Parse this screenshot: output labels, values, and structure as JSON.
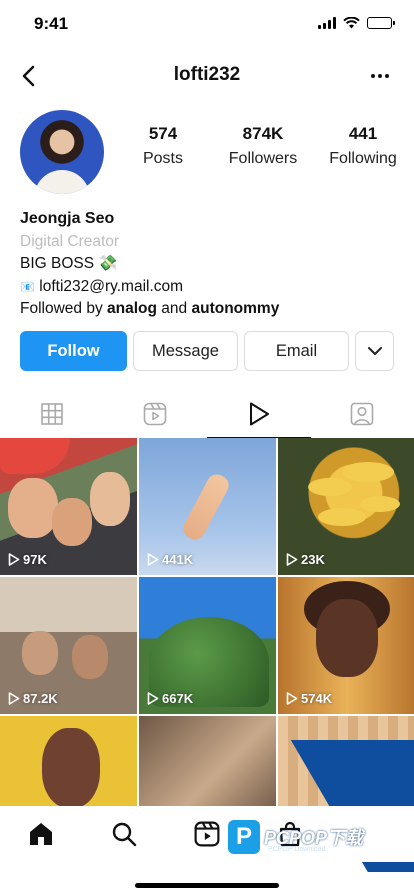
{
  "status_bar": {
    "time": "9:41"
  },
  "header": {
    "username": "lofti232"
  },
  "profile": {
    "stats": [
      {
        "value": "574",
        "label": "Posts"
      },
      {
        "value": "874K",
        "label": "Followers"
      },
      {
        "value": "441",
        "label": "Following"
      }
    ],
    "name": "Jeongja Seo",
    "category": "Digital Creator",
    "bio_line": "BIG BOSS",
    "bio_emoji": "💸",
    "email_icon": "📧",
    "email": "lofti232@ry.mail.com",
    "followed_by_prefix": "Followed by",
    "followed_by_user1": "analog",
    "followed_by_and": "and",
    "followed_by_user2": "autonommy"
  },
  "actions": {
    "follow": "Follow",
    "message": "Message",
    "email": "Email"
  },
  "tabs": [
    {
      "icon": "grid-icon",
      "active": false
    },
    {
      "icon": "reels-icon",
      "active": false
    },
    {
      "icon": "video-play-icon",
      "active": true
    },
    {
      "icon": "tagged-icon",
      "active": false
    }
  ],
  "grid": [
    {
      "views": "97K"
    },
    {
      "views": "441K"
    },
    {
      "views": "23K"
    },
    {
      "views": "87.2K"
    },
    {
      "views": "667K"
    },
    {
      "views": "574K"
    },
    {
      "views": ""
    },
    {
      "views": ""
    },
    {
      "views": ""
    }
  ],
  "watermark": {
    "text": "PCPOP下载",
    "sub": "PCPOP Download"
  },
  "bottom_nav": [
    "home-icon",
    "search-icon",
    "reels-icon",
    "shop-icon"
  ],
  "colors": {
    "follow_button": "#1e95f3",
    "category_text": "#bdbdbd",
    "watermark": "#0f4d9f"
  }
}
